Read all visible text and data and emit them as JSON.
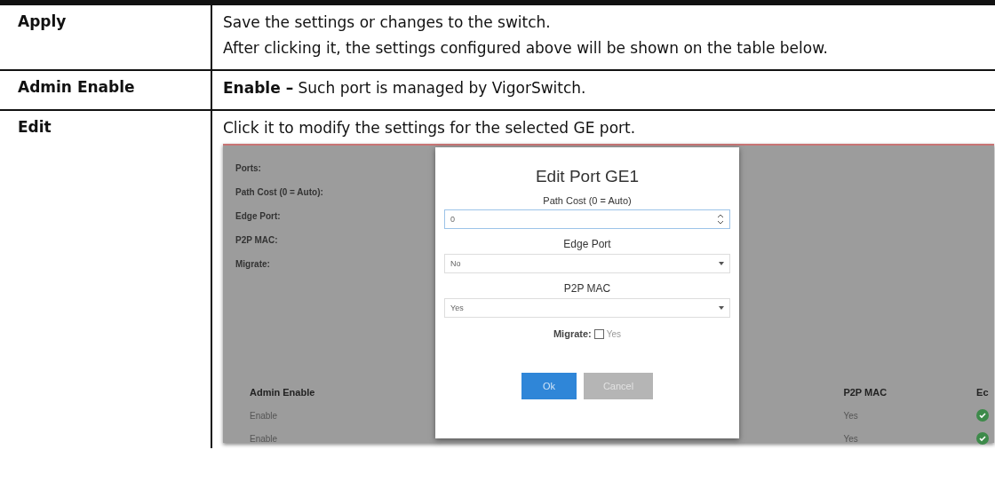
{
  "rows": [
    {
      "term": "Apply",
      "paragraphs": [
        "Save the settings or changes to the switch.",
        "After clicking it, the settings configured above will be shown on the table below."
      ]
    },
    {
      "term": "Admin Enable",
      "paragraphs": [
        "**Enable –** Such port is managed by VigorSwitch."
      ]
    },
    {
      "term": "Edit",
      "paragraphs": [
        "Click it to modify the settings for the selected GE port."
      ],
      "screenshot": {
        "form_labels": [
          "Ports:",
          "Path Cost (0 = Auto):",
          "Edge Port:",
          "P2P MAC:",
          "Migrate:"
        ],
        "table": {
          "columns": [
            "Admin Enable",
            "P2P MAC",
            "Ec"
          ],
          "rows": [
            {
              "admin_enable": "Enable",
              "p2p_mac": "Yes"
            },
            {
              "admin_enable": "Enable",
              "p2p_mac": "Yes"
            }
          ]
        },
        "dialog": {
          "title": "Edit Port GE1",
          "fields": [
            {
              "kind": "number",
              "label": "Path Cost (0 = Auto)",
              "value": "0"
            },
            {
              "kind": "select",
              "label": "Edge Port",
              "value": "No"
            },
            {
              "kind": "select",
              "label": "P2P MAC",
              "value": "Yes"
            }
          ],
          "migrate": {
            "label": "Migrate:",
            "option": "Yes",
            "checked": false
          },
          "buttons": [
            {
              "kind": "primary",
              "label": "Ok"
            },
            {
              "kind": "secondary",
              "label": "Cancel"
            }
          ]
        }
      }
    }
  ]
}
